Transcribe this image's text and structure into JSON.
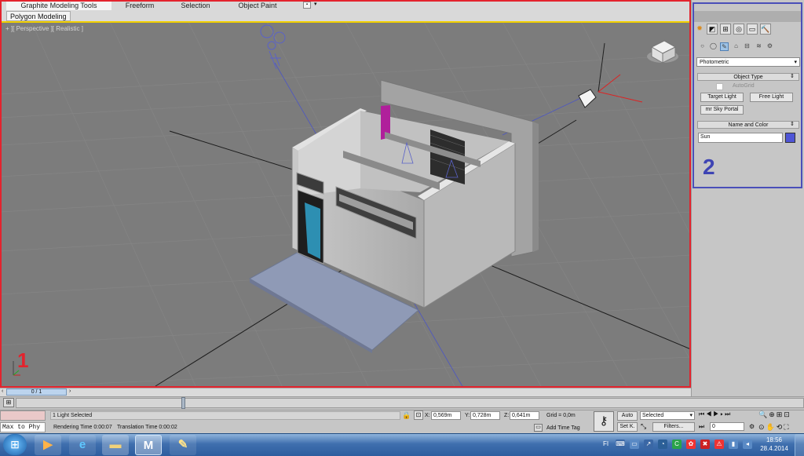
{
  "ribbon": {
    "tabs": [
      "Graphite Modeling Tools",
      "Freeform",
      "Selection",
      "Object Paint"
    ],
    "subtab": "Polygon Modeling"
  },
  "viewport": {
    "label": "+ ][ Perspective ][ Realistic ]",
    "annotation": "1"
  },
  "timeline": {
    "frame_counter": "0 / 1"
  },
  "status": {
    "selection": "1 Light Selected",
    "rendering_time": "Rendering Time  0:00:07",
    "translation_time": "Translation Time  0:00:02",
    "x_label": "X:",
    "x_value": "0,569m",
    "y_label": "Y:",
    "y_value": "0,728m",
    "z_label": "Z:",
    "z_value": "0,641m",
    "grid": "Grid = 0,0m",
    "add_time_tag": "Add Time Tag",
    "auto_key": "Auto",
    "set_key": "Set K.",
    "selected_dropdown": "Selected",
    "filters": "Filters...",
    "frame_field": "0",
    "maxscript": "Max to Phy"
  },
  "command_panel": {
    "category_dropdown": "Photometric",
    "object_type_header": "Object Type",
    "autogrid": "AutoGrid",
    "target_light": "Target Light",
    "free_light": "Free Light",
    "mr_sky_portal": "mr Sky Portal",
    "name_color_header": "Name and Color",
    "name_value": "Sun",
    "color_swatch": "#4f55d6",
    "annotation": "2"
  },
  "taskbar": {
    "language": "FI",
    "time": "18:56",
    "date": "28.4.2014",
    "apps": [
      "start-orb",
      "media-player",
      "internet-explorer",
      "file-explorer",
      "3ds-max",
      "paint"
    ]
  },
  "colors": {
    "annotation_frame_1": "#e3232d",
    "annotation_frame_2": "#4a4fb9",
    "viewport_bg": "#7c7c7c"
  }
}
